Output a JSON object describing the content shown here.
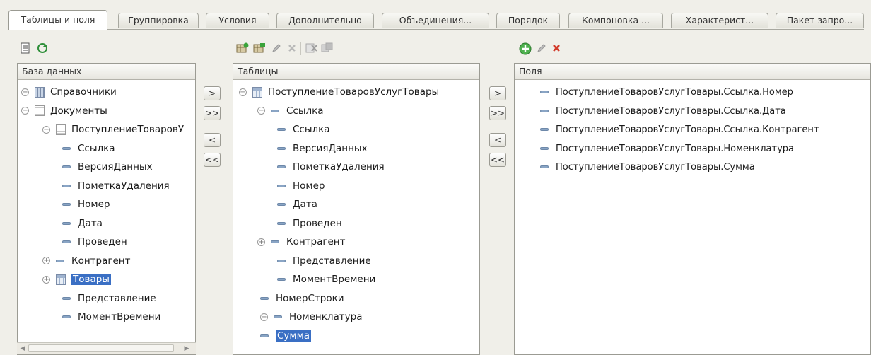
{
  "tabs": [
    {
      "label": "Таблицы и поля",
      "active": true
    },
    {
      "label": "Группировка"
    },
    {
      "label": "Условия"
    },
    {
      "label": "Дополнительно"
    },
    {
      "label": "Объединения..."
    },
    {
      "label": "Порядок"
    },
    {
      "label": "Компоновка ..."
    },
    {
      "label": "Характерист..."
    },
    {
      "label": "Пакет запро..."
    }
  ],
  "toolbar_db": [
    "list-icon",
    "refresh-icon"
  ],
  "toolbar_tables": [
    "add-table-icon",
    "add-nested-icon",
    "edit-icon",
    "delete-icon",
    "cut-icon",
    "replace-icon"
  ],
  "toolbar_fields": [
    "add-icon",
    "edit-icon",
    "delete-icon"
  ],
  "panels": {
    "db": {
      "header": "База данных"
    },
    "tables": {
      "header": "Таблицы"
    },
    "fields": {
      "header": "Поля"
    }
  },
  "db_tree": [
    {
      "label": "Справочники",
      "expander": "plus",
      "icon": "catalog"
    },
    {
      "label": "Документы",
      "expander": "minus",
      "icon": "doc"
    },
    {
      "label": "ПоступлениеТоваровУ",
      "expander": "minus",
      "icon": "doc"
    },
    {
      "label": "Ссылка"
    },
    {
      "label": "ВерсияДанных"
    },
    {
      "label": "ПометкаУдаления"
    },
    {
      "label": "Номер"
    },
    {
      "label": "Дата"
    },
    {
      "label": "Проведен"
    },
    {
      "label": "Контрагент",
      "expander": "plus"
    },
    {
      "label": "Товары",
      "expander": "plus",
      "icon": "table",
      "selected": true
    },
    {
      "label": "Представление"
    },
    {
      "label": "МоментВремени"
    }
  ],
  "tables_tree": [
    {
      "label": "ПоступлениеТоваровУслугТовары",
      "expander": "minus",
      "icon": "table"
    },
    {
      "label": "Ссылка",
      "expander": "minus"
    },
    {
      "label": "Ссылка"
    },
    {
      "label": "ВерсияДанных"
    },
    {
      "label": "ПометкаУдаления"
    },
    {
      "label": "Номер"
    },
    {
      "label": "Дата"
    },
    {
      "label": "Проведен"
    },
    {
      "label": "Контрагент",
      "expander": "plus"
    },
    {
      "label": "Представление"
    },
    {
      "label": "МоментВремени"
    },
    {
      "label": "НомерСтроки"
    },
    {
      "label": "Номенклатура",
      "expander": "plus"
    },
    {
      "label": "Сумма",
      "selected": true
    }
  ],
  "fields_list": [
    "ПоступлениеТоваровУслугТовары.Ссылка.Номер",
    "ПоступлениеТоваровУслугТовары.Ссылка.Дата",
    "ПоступлениеТоваровУслугТовары.Ссылка.Контрагент",
    "ПоступлениеТоваровУслугТовары.Номенклатура",
    "ПоступлениеТоваровУслугТовары.Сумма"
  ],
  "buttons": {
    "add_one": ">",
    "add_all": ">>",
    "remove_one": "<",
    "remove_all": "<<"
  }
}
